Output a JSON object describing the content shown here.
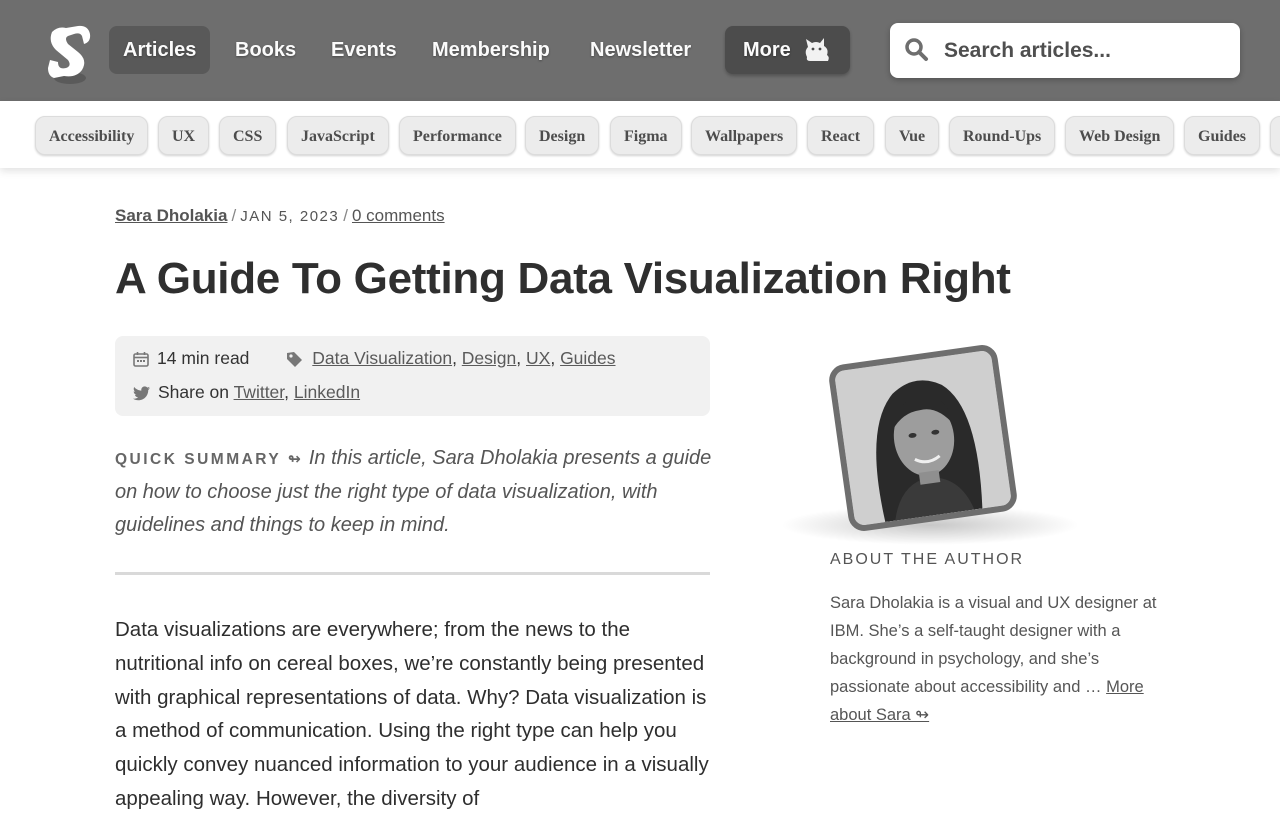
{
  "nav": {
    "items": [
      "Articles",
      "Books",
      "Events",
      "Membership",
      "Newsletter"
    ],
    "active": "Articles",
    "more_label": "More",
    "bg_color": "#6e6e6e"
  },
  "search": {
    "placeholder": "Search articles..."
  },
  "categories": [
    "Accessibility",
    "UX",
    "CSS",
    "JavaScript",
    "Performance",
    "Design",
    "Figma",
    "Wallpapers",
    "React",
    "Vue",
    "Round-Ups",
    "Web Design",
    "Guides"
  ],
  "article": {
    "author": "Sara Dholakia",
    "date": "JAN 5, 2023",
    "comments": "0 comments",
    "title": "A Guide To Getting Data Visualization Right",
    "read_time": "14 min read",
    "tags": [
      "Data Visualization",
      "Design",
      "UX",
      "Guides"
    ],
    "share_prefix": "Share on",
    "share_links": [
      "Twitter",
      "LinkedIn"
    ],
    "summary_label": "QUICK SUMMARY ↬",
    "summary_text": "In this article, Sara Dholakia presents a guide on how to choose just the right type of data visualization, with guidelines and things to keep in mind.",
    "body": "Data visualizations are everywhere; from the news to the nutritional info on cereal boxes, we’re constantly being presented with graphical representations of data. Why? Data visualization is a method of communication. Using the right type can help you quickly convey nuanced information to your audience in a visually appealing way. However, the diversity of"
  },
  "author_box": {
    "label": "ABOUT THE AUTHOR",
    "bio": "Sara Dholakia is a visual and UX designer at IBM. She’s a self-taught designer with a background in psychology, and she’s passionate about accessibility and …",
    "more_link": "More about Sara ↬"
  }
}
